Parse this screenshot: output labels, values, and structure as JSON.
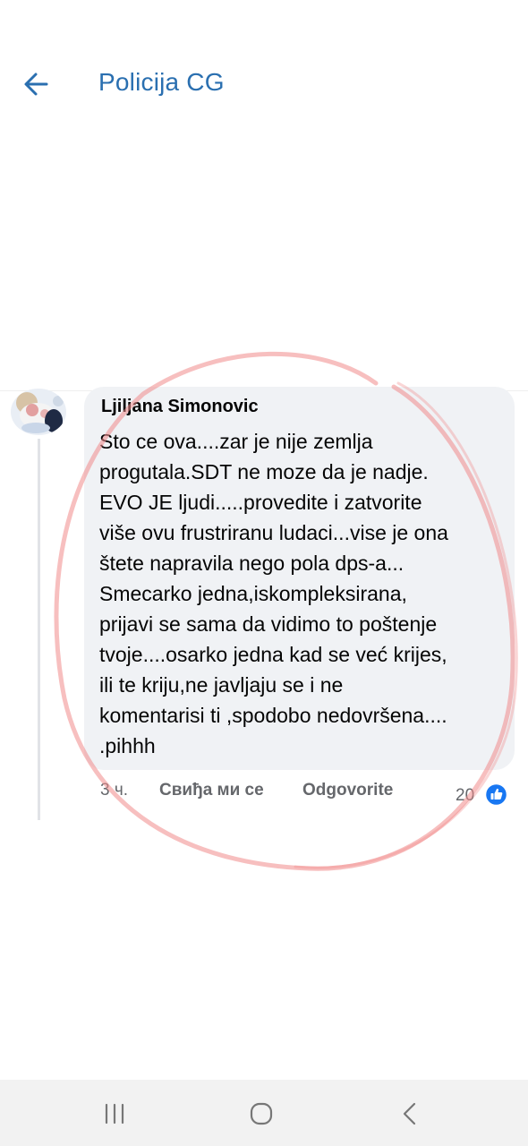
{
  "header": {
    "title": "Policija CG",
    "back_icon": "arrow-left-icon",
    "accent_color": "#2a6fb0"
  },
  "comment": {
    "author": "Ljiljana Simonovic",
    "lines": [
      "Sto ce ova....zar je nije zemlja",
      "progutala.SDT ne moze da je nadje.",
      "EVO JE ljudi.....provedite i zatvorite",
      "više ovu frustriranu ludaci...vise je ona",
      "štete napravila nego pola dps-a...",
      "Smecarko jedna,iskompleksirana,",
      "prijavi se sama da vidimo to poštenje",
      "tvoje....osarko jedna kad se već krijes,",
      "ili te kriju,ne javljaju se i ne",
      "komentarisi ti ,spodobo nedovršena....",
      ".pihhh"
    ],
    "time": "3 ч.",
    "like_label": "Свиђа ми се",
    "reply_label": "Odgovorite",
    "reaction_count": "20",
    "reaction_icon": "thumbs-up-icon",
    "reaction_color": "#1877f2"
  },
  "overlay": {
    "annotation": "red-hand-drawn-circle",
    "color": "#f08a8a"
  },
  "navbar": {
    "recent_icon": "recent-apps-icon",
    "home_icon": "home-circle-icon",
    "back_icon": "chevron-left-icon"
  }
}
